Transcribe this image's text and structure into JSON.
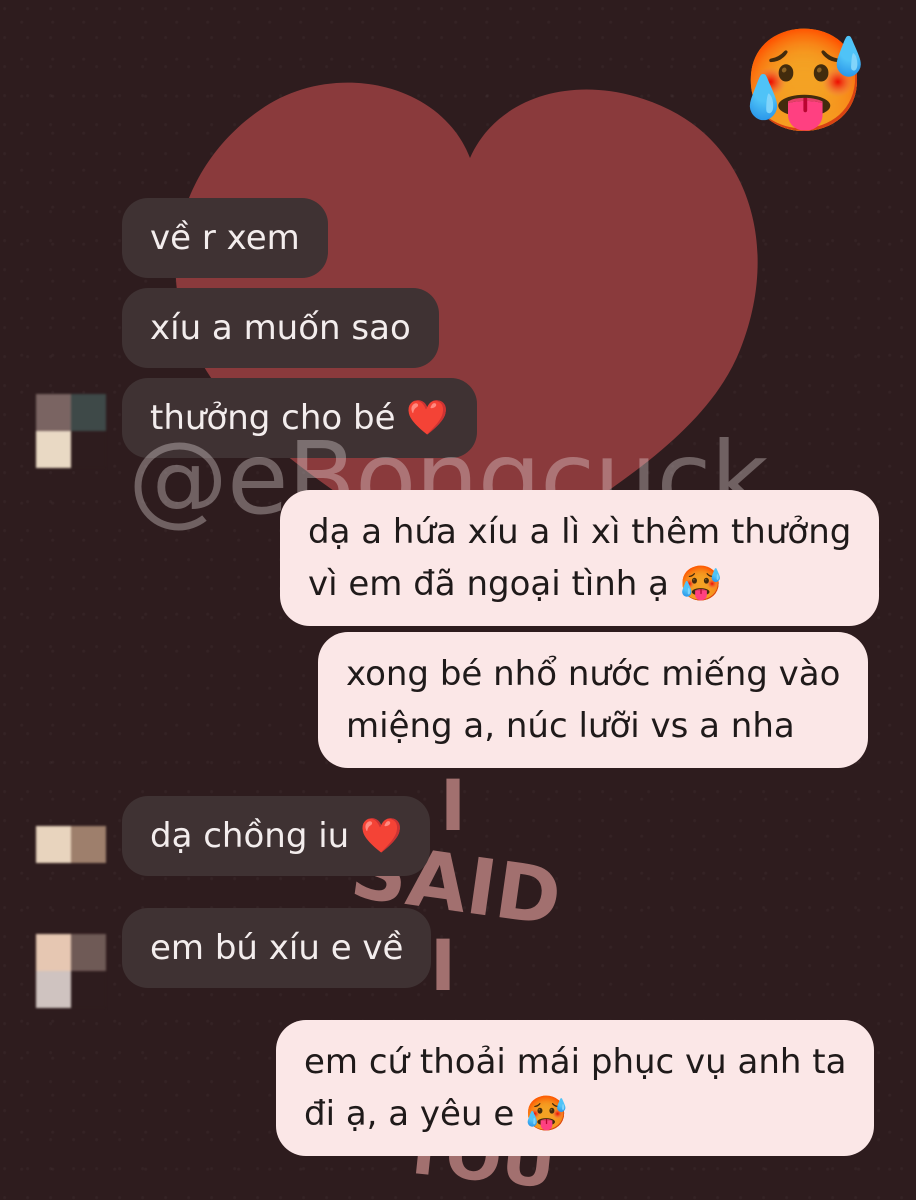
{
  "top_emoji": "🥵",
  "watermark": "@eBongcuck",
  "background_art": {
    "l1": "I",
    "l2": "SAID",
    "l3": "I",
    "l4": "YOU"
  },
  "messages": [
    {
      "dir": "in",
      "text": "về r xem"
    },
    {
      "dir": "in",
      "text": "xíu a muốn sao"
    },
    {
      "dir": "in",
      "text": "thưởng cho bé ❤️"
    },
    {
      "dir": "out",
      "line1": "dạ a hứa xíu a lì xì thêm thưởng",
      "line2": "vì em đã ngoại tình ạ 🥵"
    },
    {
      "dir": "out",
      "line1": "xong bé nhổ nước miếng vào",
      "line2": "miệng a, núc lưỡi vs a nha"
    },
    {
      "dir": "in",
      "text": "dạ chồng iu ❤️"
    },
    {
      "dir": "in",
      "text": "em bú xíu e về"
    },
    {
      "dir": "out",
      "line1": "em cứ thoải mái phục vụ anh ta",
      "line2": "đi ạ, a yêu e 🥵"
    }
  ],
  "colors": {
    "background": "#2e1c1e",
    "heart": "#8a3a3c",
    "incoming_bubble": "#3f3233",
    "outgoing_bubble": "#fbe7e7"
  }
}
